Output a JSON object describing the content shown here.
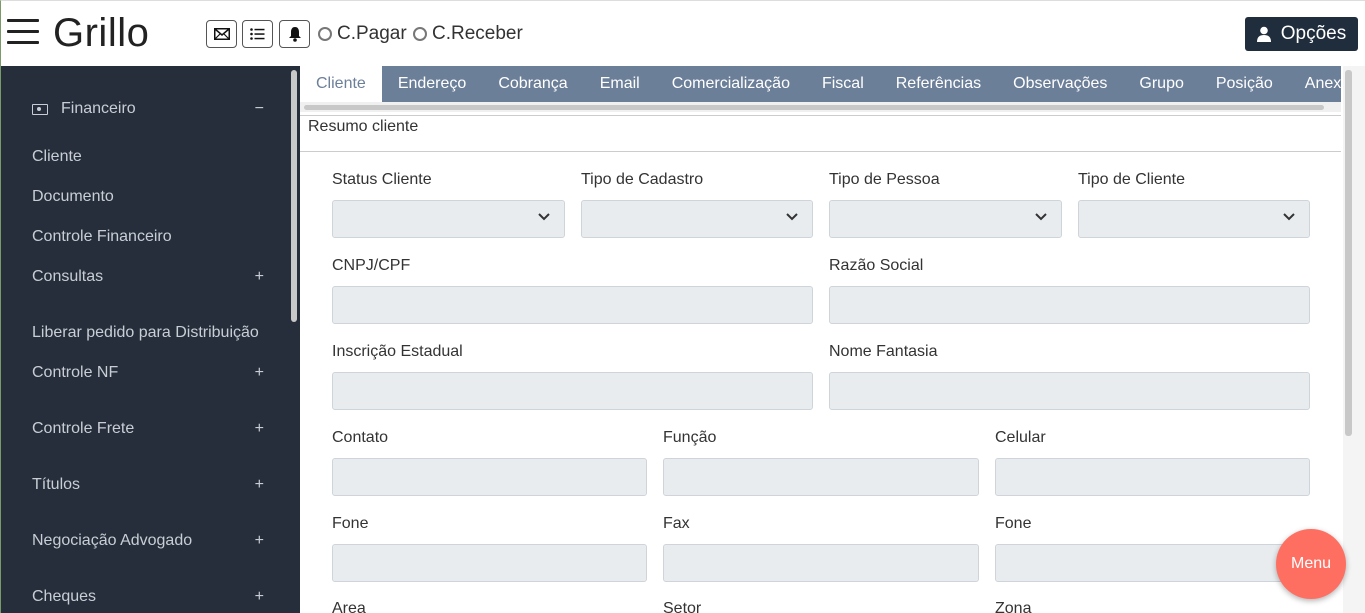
{
  "header": {
    "brand": "Grillo",
    "radio_pagar": "C.Pagar",
    "radio_receber": "C.Receber",
    "options_label": "Opções",
    "icons": [
      "envelope-icon",
      "list-icon",
      "bell-icon",
      "user-icon"
    ]
  },
  "sidebar": {
    "items": [
      {
        "label": "Financeiro",
        "toggle": "−"
      },
      {
        "label": "Cliente",
        "toggle": ""
      },
      {
        "label": "Documento",
        "toggle": ""
      },
      {
        "label": "Controle Financeiro",
        "toggle": ""
      },
      {
        "label": "Consultas",
        "toggle": "+"
      },
      {
        "label": "Liberar pedido para Distribuição",
        "toggle": ""
      },
      {
        "label": "Controle NF",
        "toggle": "+"
      },
      {
        "label": "Controle Frete",
        "toggle": "+"
      },
      {
        "label": "Títulos",
        "toggle": "+"
      },
      {
        "label": "Negociação Advogado",
        "toggle": "+"
      },
      {
        "label": "Cheques",
        "toggle": "+"
      }
    ]
  },
  "tabs": [
    "Cliente",
    "Endereço",
    "Cobrança",
    "Email",
    "Comercialização",
    "Fiscal",
    "Referências",
    "Observações",
    "Grupo",
    "Posição",
    "Anexos"
  ],
  "section_title": "Resumo cliente",
  "form": {
    "status_cliente": {
      "label": "Status Cliente",
      "value": ""
    },
    "tipo_cadastro": {
      "label": "Tipo de Cadastro",
      "value": ""
    },
    "tipo_pessoa": {
      "label": "Tipo de Pessoa",
      "value": ""
    },
    "tipo_cliente": {
      "label": "Tipo de Cliente",
      "value": ""
    },
    "cnpj_cpf": {
      "label": "CNPJ/CPF",
      "value": ""
    },
    "razao_social": {
      "label": "Razão Social",
      "value": ""
    },
    "inscricao_estadual": {
      "label": "Inscrição Estadual",
      "value": ""
    },
    "nome_fantasia": {
      "label": "Nome Fantasia",
      "value": ""
    },
    "contato": {
      "label": "Contato",
      "value": ""
    },
    "funcao": {
      "label": "Função",
      "value": ""
    },
    "celular": {
      "label": "Celular",
      "value": ""
    },
    "fone1": {
      "label": "Fone",
      "value": ""
    },
    "fax": {
      "label": "Fax",
      "value": ""
    },
    "fone2": {
      "label": "Fone",
      "value": ""
    },
    "area": {
      "label": "Area",
      "value": ""
    },
    "setor": {
      "label": "Setor",
      "value": ""
    },
    "zona": {
      "label": "Zona",
      "value": ""
    }
  },
  "fab": {
    "label": "Menu"
  },
  "colors": {
    "sidebar_bg": "#252e3a",
    "tab_bar": "#6c7f99",
    "fab": "#ff6f61",
    "options_btn": "#1f2d3d"
  }
}
